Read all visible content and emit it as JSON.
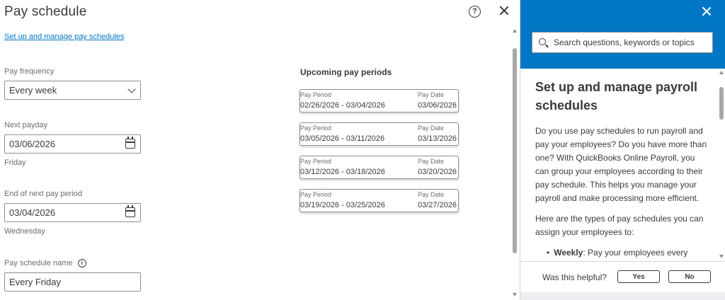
{
  "dialog": {
    "title": "Pay schedule",
    "help_label": "?",
    "manage_link": "Set up and manage pay schedules"
  },
  "form": {
    "pay_frequency": {
      "label": "Pay frequency",
      "value": "Every week"
    },
    "next_payday": {
      "label": "Next payday",
      "value": "03/06/2026",
      "day": "Friday"
    },
    "end_of_period": {
      "label": "End of next pay period",
      "value": "03/04/2026",
      "day": "Wednesday"
    },
    "schedule_name": {
      "label": "Pay schedule name",
      "info": "i",
      "value": "Every Friday"
    }
  },
  "upcoming": {
    "title": "Upcoming pay periods",
    "period_label": "Pay Period",
    "date_label": "Pay Date",
    "periods": [
      {
        "period": "02/26/2026 - 03/04/2026",
        "date": "03/06/2026"
      },
      {
        "period": "03/05/2026 - 03/11/2026",
        "date": "03/13/2026"
      },
      {
        "period": "03/12/2026 - 03/18/2026",
        "date": "03/20/2026"
      },
      {
        "period": "03/19/2026 - 03/25/2026",
        "date": "03/27/2026"
      }
    ]
  },
  "help_panel": {
    "search_placeholder": "Search questions, keywords or topics",
    "article_title": "Set up and manage payroll schedules",
    "paragraphs": [
      "Do you use pay schedules to run payroll and pay your employees? Do you have more than one? With QuickBooks Online Payroll, you can group your employees according to their pay schedule. This helps you manage your payroll and make processing more efficient.",
      "Here are the types of pay schedules you can assign your employees to:"
    ],
    "bullet_bold": "Weekly",
    "bullet_text": ": Pay your employees every",
    "feedback_question": "Was this helpful?",
    "yes_label": "Yes",
    "no_label": "No"
  },
  "colors": {
    "accent": "#0077c5",
    "text": "#393a3d",
    "muted": "#6b6c72",
    "border": "#8d9096"
  }
}
